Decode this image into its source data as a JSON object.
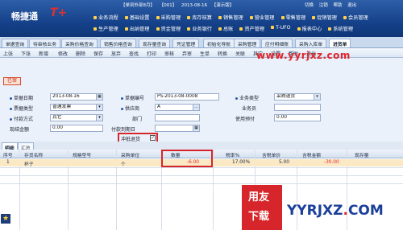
{
  "app": {
    "logo_text": "畅捷通",
    "logo_mark": "T+"
  },
  "status": {
    "account": "【单到外部8月】",
    "code": "【001】",
    "date": "2013-08-16",
    "role": "【演示版】",
    "actions": [
      "切换",
      "注销",
      "帮助",
      "退出"
    ]
  },
  "menu": {
    "row1": [
      "业务流程",
      "基础设置",
      "采购管理",
      "库存核算",
      "销售管理",
      "营业管理",
      "零售管理",
      "促销管理",
      "会员管理"
    ],
    "row2": [
      "生产管理",
      "出纳管理",
      "资金管理",
      "业务银行",
      "总账",
      "资产管理",
      "T-UFO",
      "报表中心",
      "系统管理"
    ]
  },
  "tabs": [
    "单据查询",
    "待审核业务",
    "采购价格查询",
    "销售价格查询",
    "现存量查询",
    "凭证管理",
    "初始化导航",
    "采购管理",
    "应付明细账",
    "采购入库单",
    "进货单"
  ],
  "active_tab": "进货单",
  "toolbar": [
    "上张",
    "下张",
    "新增",
    "修改",
    "删除",
    "保存",
    "放弃",
    "查找",
    "打印",
    "审核",
    "弃审",
    "生单",
    "转换",
    "关联",
    "其它",
    "设置",
    "帮助",
    "退出"
  ],
  "form": {
    "status_badge": "已审",
    "date_label": "单据日期",
    "date_value": "2013-08-16",
    "number_label": "单据编号",
    "number_value": "PS-2013-08-0008",
    "biztype_label": "业务类型",
    "biztype_value": "采购退货",
    "invoice_label": "票据类型",
    "invoice_value": "普通发票",
    "supplier_label": "供应商",
    "supplier_value": "A",
    "dept_label": "部门",
    "clerk_label": "业务员",
    "paymode_label": "付款方式",
    "paymode_value": "其它",
    "paydate_label": "付款到期日",
    "prepay_label": "使用预付",
    "prepay_value": "0.00",
    "cash_label": "现结金额",
    "cash_value": "0.00",
    "writeoff_label": "冲抵退货",
    "writeoff_checked": "✓"
  },
  "grid": {
    "tabs": [
      "明细",
      "汇总"
    ],
    "headers": [
      "序号",
      "存货名称",
      "规格型号",
      "采购单位",
      "数量",
      "税率%",
      "含税单价",
      "含税金额",
      "现存量"
    ],
    "rows": [
      {
        "no": "1",
        "name": "杯子",
        "spec": "",
        "unit": "个",
        "qty": "-6.00",
        "tax": "17.00%",
        "price": "5.00",
        "amount": "-30.00",
        "stock": ""
      }
    ]
  },
  "watermark": "www.yyrjxz.com",
  "brand": {
    "badge_line1": "用友",
    "badge_line2": "下载",
    "site_main": "YYRJXZ",
    "site_dot": ".",
    "site_tld": "COM"
  }
}
